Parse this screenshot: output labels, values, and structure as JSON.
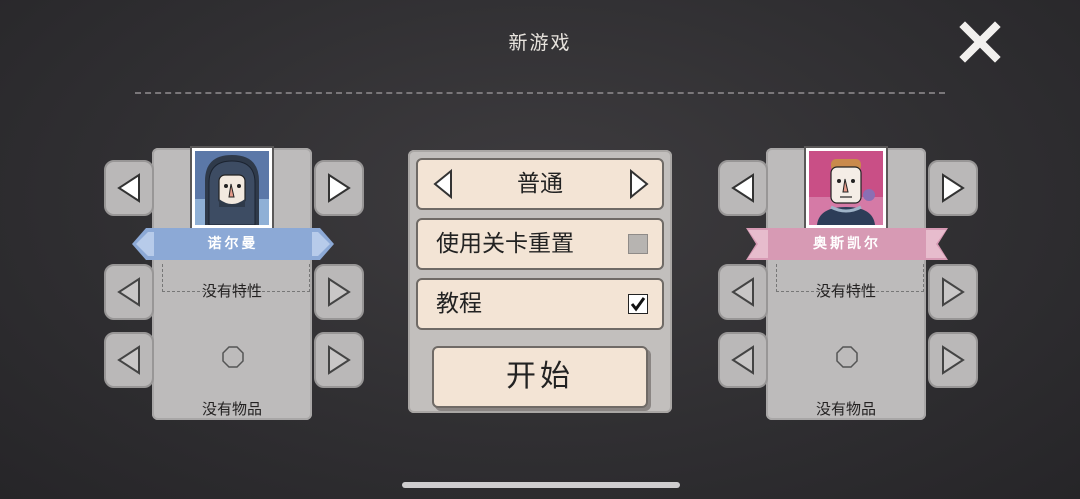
{
  "header": {
    "title": "新游戏",
    "close_icon": "close-icon"
  },
  "left_player": {
    "name": "诺尔曼",
    "banner_color": "#8ca9d6",
    "trait": "没有特性",
    "item": "没有物品"
  },
  "right_player": {
    "name": "奥斯凯尔",
    "banner_color": "#d79ab4",
    "trait": "没有特性",
    "item": "没有物品"
  },
  "settings": {
    "difficulty": "普通",
    "level_reset_label": "使用关卡重置",
    "level_reset_checked": false,
    "tutorial_label": "教程",
    "tutorial_checked": true,
    "start_label": "开始"
  }
}
